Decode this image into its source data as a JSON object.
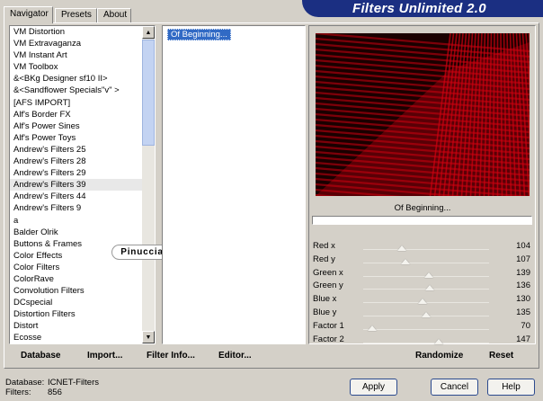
{
  "tabs": [
    "Navigator",
    "Presets",
    "About"
  ],
  "banner_title": "Filters Unlimited 2.0",
  "categories": [
    "VM Distortion",
    "VM Extravaganza",
    "VM Instant Art",
    "VM Toolbox",
    "&<BKg Designer sf10 II>",
    "&<Sandflower Specials\"v\" >",
    "[AFS IMPORT]",
    "Alf's Border FX",
    "Alf's Power Sines",
    "Alf's Power Toys",
    "Andrew's Filters 25",
    "Andrew's Filters 28",
    "Andrew's Filters 29",
    "Andrew's Filters 39",
    "Andrew's Filters 44",
    "Andrew's Filters 9",
    "a",
    "Balder Olrik",
    "Buttons & Frames",
    "Color Effects",
    "Color Filters",
    "ColorRave",
    "Convolution Filters",
    "DCspecial",
    "Distortion Filters",
    "Distort",
    "Ecosse"
  ],
  "selected_category": "Andrew's Filters 39",
  "filters": [
    "Of Beginning..."
  ],
  "selected_filter_name": "Of Beginning...",
  "watermark": "Pinuccia",
  "sliders": [
    {
      "label": "Red x",
      "value": "104"
    },
    {
      "label": "Red y",
      "value": "107"
    },
    {
      "label": "Green x",
      "value": "139"
    },
    {
      "label": "Green y",
      "value": "136"
    },
    {
      "label": "Blue x",
      "value": "130"
    },
    {
      "label": "Blue y",
      "value": "135"
    },
    {
      "label": "Factor 1",
      "value": "70"
    },
    {
      "label": "Factor 2",
      "value": "147"
    }
  ],
  "toolbar": {
    "database": "Database",
    "import": "Import...",
    "filter_info": "Filter Info...",
    "editor": "Editor...",
    "randomize": "Randomize",
    "reset": "Reset"
  },
  "status": {
    "database_label": "Database:",
    "database_value": "ICNET-Filters",
    "filters_label": "Filters:",
    "filters_value": "856"
  },
  "buttons": {
    "apply": "Apply",
    "cancel": "Cancel",
    "help": "Help"
  },
  "colors": {
    "banner": "#1b2f82",
    "selection": "#316ac5",
    "preview_red": "#d00010"
  }
}
